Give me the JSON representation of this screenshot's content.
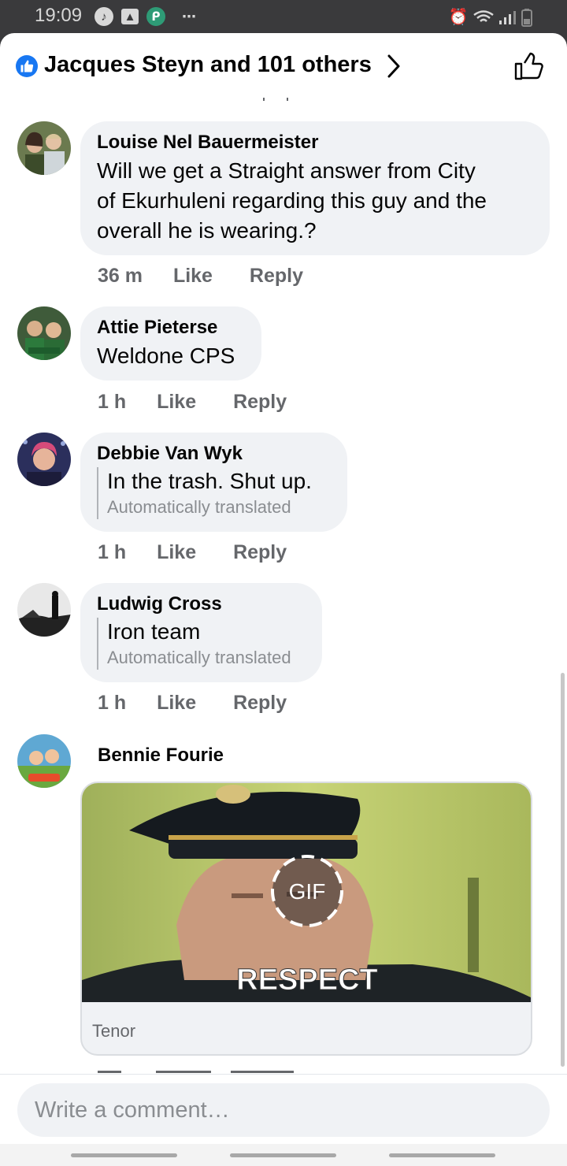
{
  "status_bar": {
    "time": "19:09"
  },
  "header": {
    "title": "Jacques Steyn and 101 others"
  },
  "comments": [
    {
      "author": "Louise Nel Bauermeister",
      "lines": [
        "Will we get a Straight answer from City",
        "of Ekurhuleni regarding this guy and the",
        "overall he is wearing.?"
      ],
      "time": "36 m",
      "like": "Like",
      "reply": "Reply"
    },
    {
      "author": "Attie Pieterse",
      "lines": [
        "Weldone CPS"
      ],
      "time": "1 h",
      "like": "Like",
      "reply": "Reply"
    },
    {
      "author": "Debbie Van Wyk",
      "lines": [
        "In the trash. Shut up."
      ],
      "translated_note": "Automatically translated",
      "time": "1 h",
      "like": "Like",
      "reply": "Reply"
    },
    {
      "author": "Ludwig Cross",
      "lines": [
        "Iron team"
      ],
      "translated_note": "Automatically translated",
      "time": "1 h",
      "like": "Like",
      "reply": "Reply"
    },
    {
      "author": "Bennie Fourie",
      "gif": {
        "badge": "GIF",
        "caption": "RESPECT",
        "source": "Tenor"
      }
    }
  ],
  "composer": {
    "placeholder": "Write a comment…"
  },
  "colors": {
    "accent": "#1877f2",
    "bubble": "#f0f2f5",
    "meta": "#65676b"
  }
}
